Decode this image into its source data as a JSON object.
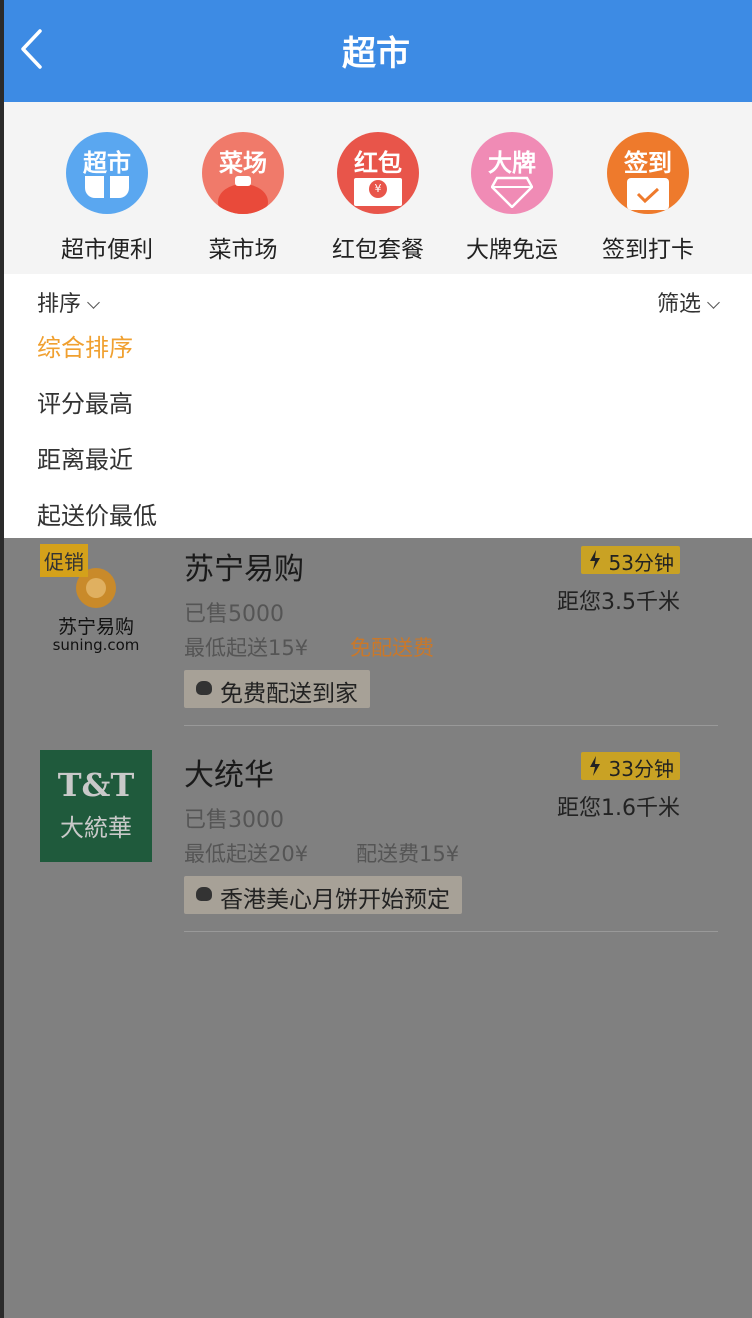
{
  "header": {
    "title": "超市",
    "back_icon": "back-arrow-icon"
  },
  "categories": [
    {
      "icon_text": "超市",
      "label": "超市便利",
      "color": "#5aa7f0",
      "icon": "supermarket-icon"
    },
    {
      "icon_text": "菜场",
      "label": "菜市场",
      "color": "#f07a6a",
      "icon": "vegetable-market-icon"
    },
    {
      "icon_text": "红包",
      "label": "红包套餐",
      "color": "#e8554a",
      "icon": "red-packet-icon"
    },
    {
      "icon_text": "大牌",
      "label": "大牌免运",
      "color": "#f08bb5",
      "icon": "diamond-icon"
    },
    {
      "icon_text": "签到",
      "label": "签到打卡",
      "color": "#ee7a2c",
      "icon": "calendar-check-icon"
    }
  ],
  "dropdown": {
    "sort_label": "排序",
    "filter_label": "筛选",
    "options": [
      "综合排序",
      "评分最高",
      "距离最近",
      "起送价最低"
    ],
    "active_index": 0
  },
  "stores": [
    {
      "promo": "促销",
      "logo_cn": "苏宁易购",
      "logo_en": "suning.com",
      "name": "苏宁易购",
      "sold": "已售5000",
      "min_order": "最低起送15¥",
      "delivery": "免配送费",
      "tag": "免费配送到家",
      "time": "53分钟",
      "distance": "距您3.5千米"
    },
    {
      "logo_line1": "T&T",
      "logo_line2": "大統華",
      "name": "大统华",
      "sold": "已售3000",
      "min_order": "最低起送20¥",
      "delivery": "配送费15¥",
      "tag": "香港美心月饼开始预定",
      "time": "33分钟",
      "distance": "距您1.6千米"
    }
  ],
  "colors": {
    "header_bg": "#3d8be4",
    "active_sort": "#f0a030",
    "overlay": "#808080"
  }
}
